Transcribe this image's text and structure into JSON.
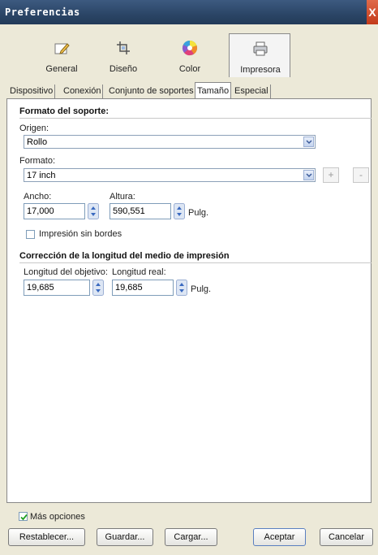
{
  "window": {
    "title": "Preferencias",
    "close_glyph": "X"
  },
  "categories": [
    {
      "label": "General",
      "icon": "pencil-icon"
    },
    {
      "label": "Diseño",
      "icon": "crop-icon"
    },
    {
      "label": "Color",
      "icon": "color-wheel-icon"
    },
    {
      "label": "Impresora",
      "icon": "printer-icon",
      "active": true
    }
  ],
  "tabs": [
    {
      "label": "Dispositivo"
    },
    {
      "label": "Conexión"
    },
    {
      "label": "Conjunto de soportes"
    },
    {
      "label": "Tamaño",
      "active": true
    },
    {
      "label": "Especial"
    }
  ],
  "media_format": {
    "section_title": "Formato del soporte:",
    "origin_label": "Origen:",
    "origin_value": "Rollo",
    "format_label": "Formato:",
    "format_value": "17 inch",
    "add_button": "+",
    "remove_button": "-",
    "width_label": "Ancho:",
    "width_value": "17,000",
    "height_label": "Altura:",
    "height_value": "590,551",
    "unit": "Pulg.",
    "borderless_label": "Impresión sin bordes",
    "borderless_checked": false
  },
  "length_correction": {
    "section_title": "Corrección de la longitud del medio de impresión",
    "target_label": "Longitud del objetivo:",
    "target_value": "19,685",
    "actual_label": "Longitud real:",
    "actual_value": "19,685",
    "unit": "Pulg."
  },
  "footer": {
    "more_options_label": "Más opciones",
    "more_options_checked": true,
    "reset_button": "Restablecer...",
    "save_button": "Guardar...",
    "load_button": "Cargar...",
    "accept_button": "Aceptar",
    "cancel_button": "Cancelar"
  },
  "colors": {
    "titlebar": "#2b4566",
    "close": "#c33a1a",
    "accent_blue": "#5a7fc0"
  }
}
